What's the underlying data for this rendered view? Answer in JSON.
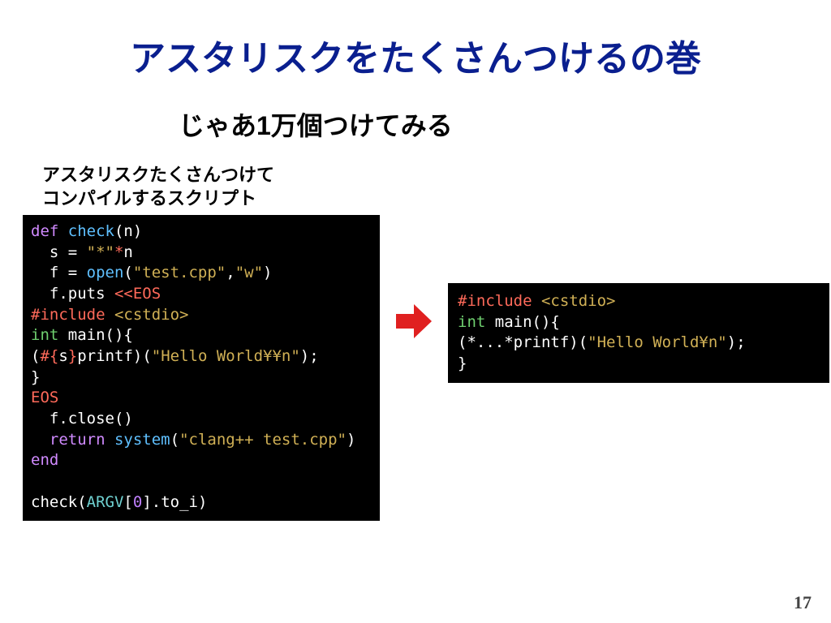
{
  "title": "アスタリスクをたくさんつけるの巻",
  "subtitle": "じゃあ1万個つけてみる",
  "caption_line1": "アスタリスクたくさんつけて",
  "caption_line2": "コンパイルするスクリプト",
  "page_number": "17",
  "code_left": {
    "l1a": "def",
    "l1b": " ",
    "l1c": "check",
    "l1d": "(n)",
    "l2": "  s = ",
    "l2s": "\"*\"",
    "l2o": "*",
    "l2e": "n",
    "l3": "  f = ",
    "l3f": "open",
    "l3p": "(",
    "l3s1": "\"test.cpp\"",
    "l3c": ",",
    "l3s2": "\"w\"",
    "l3q": ")",
    "l4": "  f.puts ",
    "l4o": "<<EOS",
    "l5a": "#include",
    "l5b": " ",
    "l5c": "<cstdio>",
    "l6a": "int",
    "l6b": " main(){",
    "l7a": "(",
    "l7b": "#{",
    "l7c": "s",
    "l7d": "}",
    "l7e": "printf)(",
    "l7f": "\"Hello World¥¥n\"",
    "l7g": ");",
    "l8": "}",
    "l9": "EOS",
    "l10": "  f.close()",
    "l11a": "  ",
    "l11b": "return",
    "l11c": " ",
    "l11d": "system",
    "l11e": "(",
    "l11f": "\"clang++ test.cpp\"",
    "l11g": ")",
    "l12": "end",
    "l13": "",
    "l14a": "check(",
    "l14b": "ARGV",
    "l14c": "[",
    "l14d": "0",
    "l14e": "].to_i)"
  },
  "code_right": {
    "r1a": "#include",
    "r1b": " ",
    "r1c": "<cstdio>",
    "r2a": "int",
    "r2b": " main(){",
    "r3a": "(*...*printf)(",
    "r3b": "\"Hello World¥n\"",
    "r3c": ");",
    "r4": "}"
  }
}
